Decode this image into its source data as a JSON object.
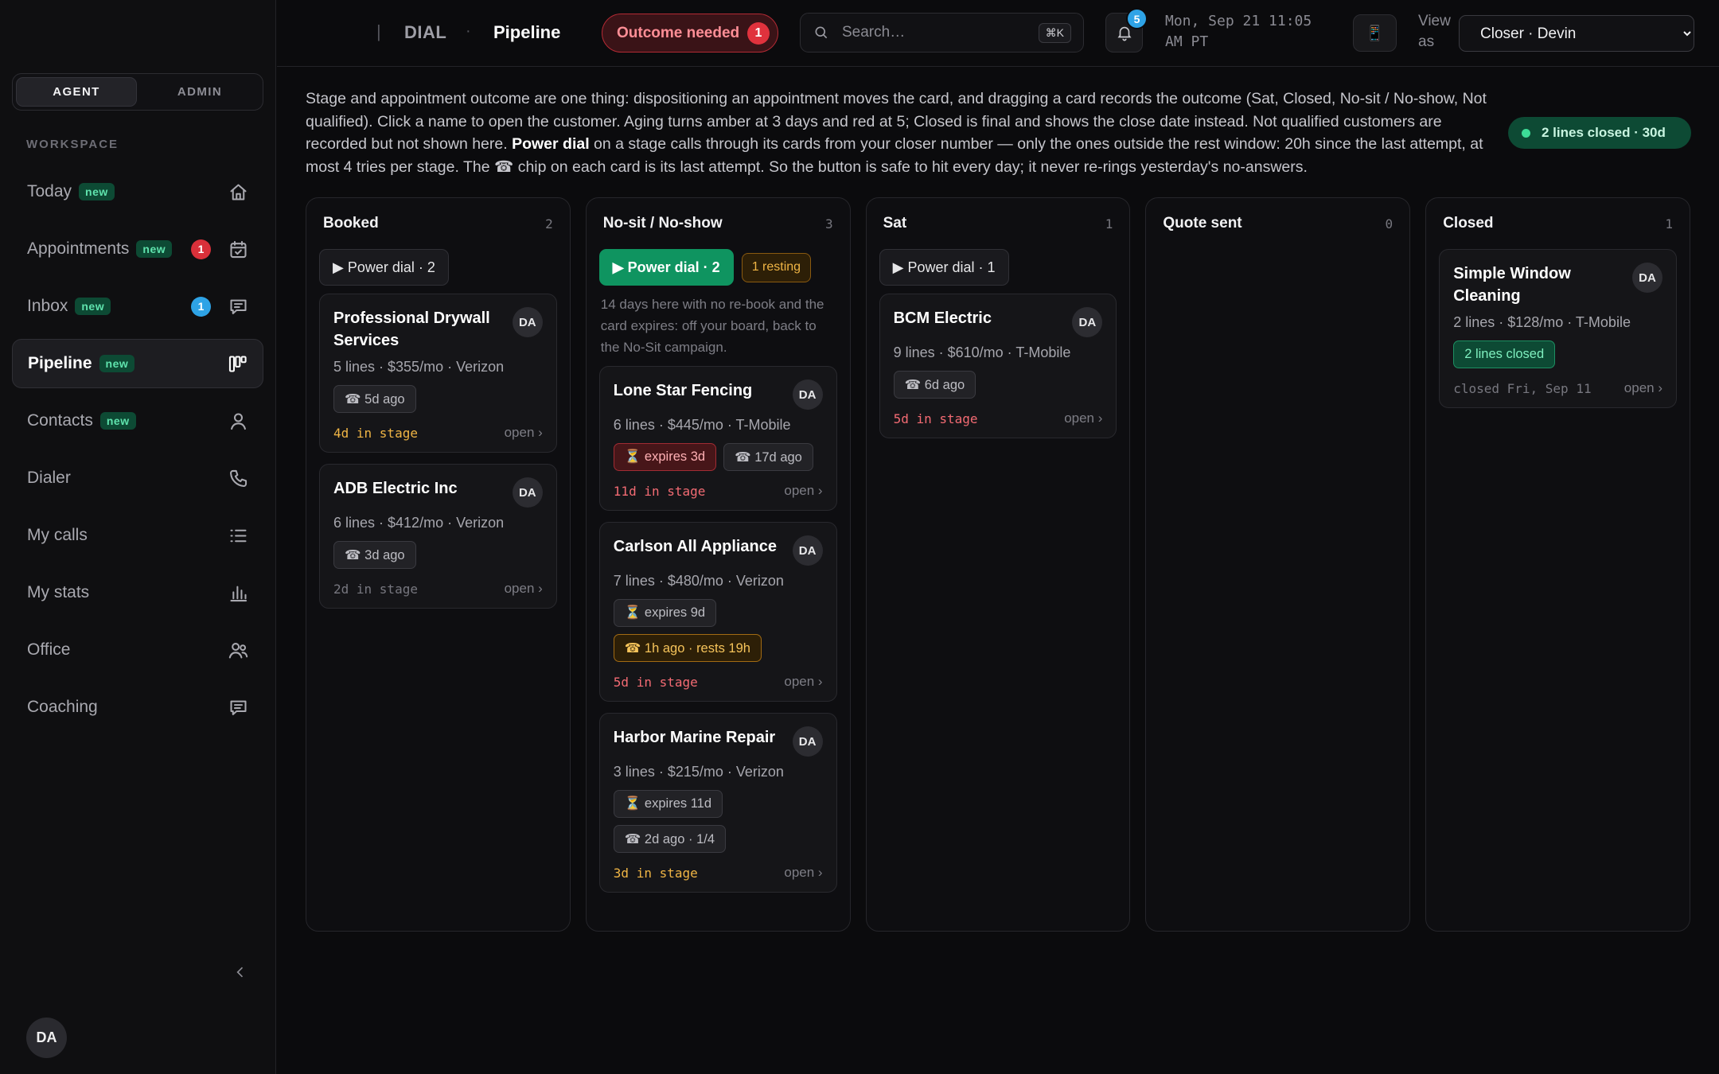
{
  "sidebar": {
    "role_tabs": [
      "AGENT",
      "ADMIN"
    ],
    "workspace_label": "WORKSPACE",
    "new_label": "new",
    "items": [
      {
        "label": "Today",
        "badge_new": true,
        "icon": "home-icon"
      },
      {
        "label": "Appointments",
        "badge_new": true,
        "count": "1",
        "count_color": "red",
        "icon": "calendar-check-icon"
      },
      {
        "label": "Inbox",
        "badge_new": true,
        "count": "1",
        "count_color": "blue",
        "icon": "message-icon"
      },
      {
        "label": "Pipeline",
        "badge_new": true,
        "active": true,
        "icon": "kanban-icon"
      },
      {
        "label": "Contacts",
        "badge_new": true,
        "icon": "person-icon"
      },
      {
        "label": "Dialer",
        "icon": "phone-icon"
      },
      {
        "label": "My calls",
        "icon": "list-icon"
      },
      {
        "label": "My stats",
        "icon": "bar-chart-icon"
      },
      {
        "label": "Office",
        "icon": "people-icon"
      },
      {
        "label": "Coaching",
        "icon": "chat-icon"
      }
    ],
    "user_initials": "DA"
  },
  "header": {
    "separator": "|",
    "app": "DIAL",
    "dot": "·",
    "page": "Pipeline",
    "outcome_label": "Outcome needed",
    "outcome_count": "1",
    "search_placeholder": "Search…",
    "search_kbd": "⌘K",
    "bell_count": "5",
    "clock": "Mon, Sep 21 11:05 AM PT",
    "phone_icon": "📱",
    "view_as_label": "View as",
    "view_as_value": "Closer · Devin"
  },
  "info": {
    "part1": "Stage and appointment outcome are one thing: dispositioning an appointment moves the card, and dragging a card records the outcome (Sat, Closed, No-sit / No-show, Not qualified). Click a name to open the customer. Aging turns amber at 3 days and red at 5; Closed is final and shows the close date instead. Not qualified customers are recorded but not shown here. ",
    "bold": "Power dial",
    "part2": " on a stage calls through its cards from your closer number — only the ones outside the rest window: 20h since the last attempt, at most 4 tries per stage. The ☎ chip on each card is its last attempt. So the button is safe to hit every day; it never re-rings yesterday's no-answers.",
    "closed_pill": "2 lines closed · 30d"
  },
  "colors": {
    "accent_green": "#0f9460",
    "alert_red": "#d9303a",
    "info_blue": "#2ea3e6",
    "aging_amber": "#f0b545",
    "aging_red": "#f36b73"
  },
  "open_label": "open ›",
  "columns": [
    {
      "title": "Booked",
      "count": "2",
      "dial": {
        "label": "▶ Power dial · 2",
        "primary": false
      },
      "cards": [
        {
          "name": "Professional Drywall Services",
          "initials": "DA",
          "meta": "5 lines · $355/mo · Verizon",
          "chips": [
            {
              "text": "☎ 5d ago",
              "tone": ""
            }
          ],
          "aging": "4d in stage",
          "aging_tone": "amber"
        },
        {
          "name": "ADB Electric Inc",
          "initials": "DA",
          "meta": "6 lines · $412/mo · Verizon",
          "chips": [
            {
              "text": "☎ 3d ago",
              "tone": ""
            }
          ],
          "aging": "2d in stage",
          "aging_tone": "gray"
        }
      ]
    },
    {
      "title": "No-sit / No-show",
      "count": "3",
      "dial": {
        "label": "▶ Power dial · 2",
        "primary": true
      },
      "resting": "1 resting",
      "note": "14 days here with no re-book and the card expires: off your board, back to the No-Sit campaign.",
      "cards": [
        {
          "name": "Lone Star Fencing",
          "initials": "DA",
          "meta": "6 lines · $445/mo · T-Mobile",
          "chips": [
            {
              "text": "⏳ expires 3d",
              "tone": "red"
            },
            {
              "text": "☎ 17d ago",
              "tone": ""
            }
          ],
          "aging": "11d in stage",
          "aging_tone": "red"
        },
        {
          "name": "Carlson All Appliance",
          "initials": "DA",
          "meta": "7 lines · $480/mo · Verizon",
          "chips": [
            {
              "text": "⏳ expires 9d",
              "tone": ""
            },
            {
              "text": "☎ 1h ago · rests 19h",
              "tone": "amber"
            }
          ],
          "aging": "5d in stage",
          "aging_tone": "red"
        },
        {
          "name": "Harbor Marine Repair",
          "initials": "DA",
          "meta": "3 lines · $215/mo · Verizon",
          "chips": [
            {
              "text": "⏳ expires 11d",
              "tone": ""
            },
            {
              "text": "☎ 2d ago · 1/4",
              "tone": ""
            }
          ],
          "aging": "3d in stage",
          "aging_tone": "amber"
        }
      ]
    },
    {
      "title": "Sat",
      "count": "1",
      "dial": {
        "label": "▶ Power dial · 1",
        "primary": false
      },
      "cards": [
        {
          "name": "BCM Electric",
          "initials": "DA",
          "meta": "9 lines · $610/mo · T-Mobile",
          "chips": [
            {
              "text": "☎ 6d ago",
              "tone": ""
            }
          ],
          "aging": "5d in stage",
          "aging_tone": "red"
        }
      ]
    },
    {
      "title": "Quote sent",
      "count": "0",
      "cards": []
    },
    {
      "title": "Closed",
      "count": "1",
      "cards": [
        {
          "name": "Simple Window Cleaning",
          "initials": "DA",
          "meta": "2 lines · $128/mo · T-Mobile",
          "chips": [
            {
              "text": "2 lines closed",
              "tone": "green"
            }
          ],
          "aging": "closed Fri, Sep 11",
          "aging_tone": "gray"
        }
      ]
    }
  ]
}
